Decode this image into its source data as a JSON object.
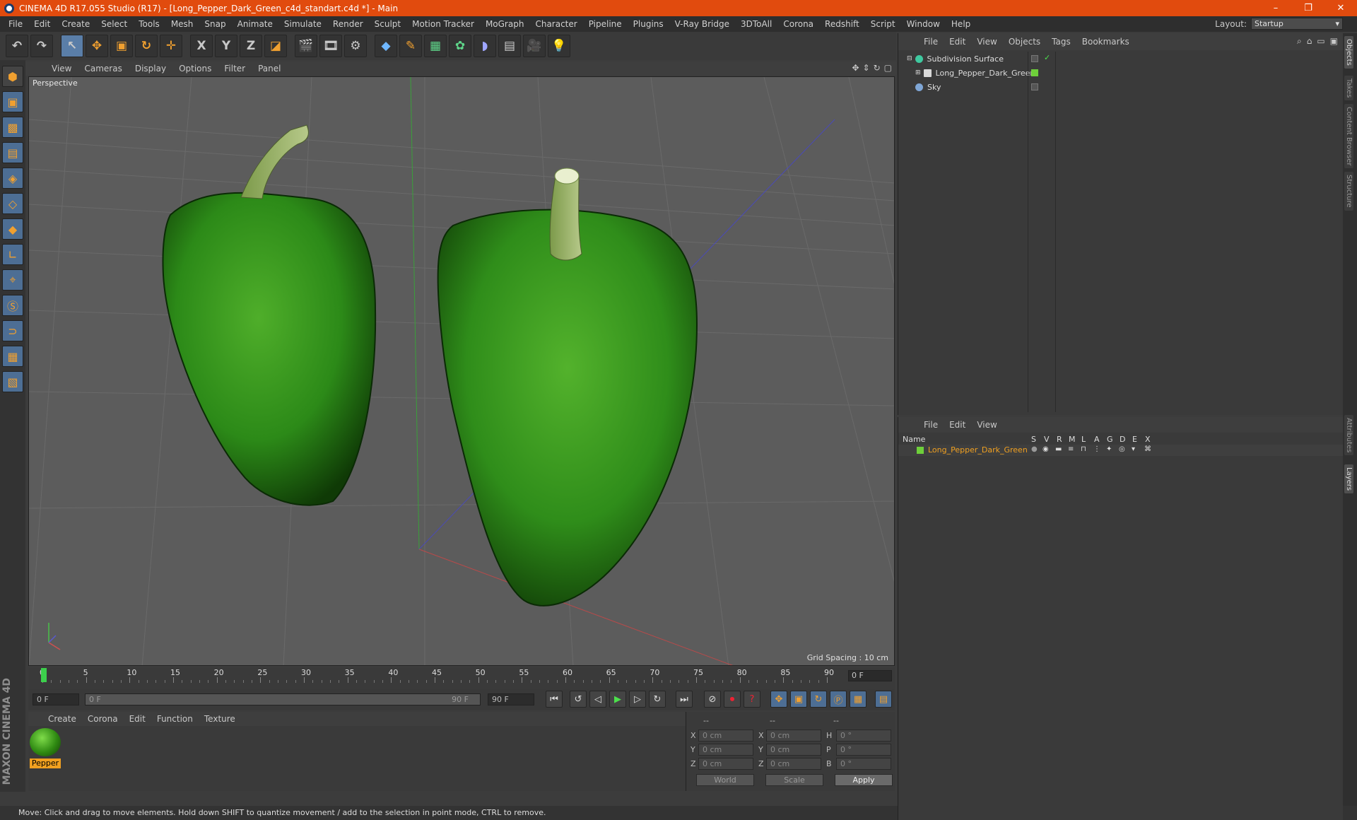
{
  "title_bar": {
    "title": "CINEMA 4D R17.055 Studio (R17) - [Long_Pepper_Dark_Green_c4d_standart.c4d *] - Main",
    "minimize": "–",
    "maximize": "❐",
    "close": "✕"
  },
  "menu": {
    "items": [
      "File",
      "Edit",
      "Create",
      "Select",
      "Tools",
      "Mesh",
      "Snap",
      "Animate",
      "Simulate",
      "Render",
      "Sculpt",
      "Motion Tracker",
      "MoGraph",
      "Character",
      "Pipeline",
      "Plugins",
      "V-Ray Bridge",
      "3DToAll",
      "Corona",
      "Redshift",
      "Script",
      "Window",
      "Help"
    ]
  },
  "layout": {
    "label": "Layout:",
    "value": "Startup"
  },
  "toolbar": {
    "undo": "↶",
    "redo": "↷",
    "axis_x": "X",
    "axis_y": "Y",
    "axis_z": "Z"
  },
  "viewport": {
    "menu": [
      "View",
      "Cameras",
      "Display",
      "Options",
      "Filter",
      "Panel"
    ],
    "label": "Perspective",
    "grid_spacing": "Grid Spacing : 10 cm"
  },
  "timeline": {
    "ticks": [
      "0",
      "5",
      "10",
      "15",
      "20",
      "25",
      "30",
      "35",
      "40",
      "45",
      "50",
      "55",
      "60",
      "65",
      "70",
      "75",
      "80",
      "85",
      "90"
    ],
    "end_field": "0 F",
    "start_field": "0 F",
    "range_start": "0 F",
    "range_end": "90 F",
    "max_field": "90 F"
  },
  "materials": {
    "menu": [
      "Create",
      "Corona",
      "Edit",
      "Function",
      "Texture"
    ],
    "items": [
      {
        "name": "Pepper"
      }
    ]
  },
  "coords": {
    "header": [
      "--",
      "--",
      "--"
    ],
    "rows": [
      {
        "a": "X",
        "v1": "0 cm",
        "b": "X",
        "v2": "0 cm",
        "c": "H",
        "v3": "0 °"
      },
      {
        "a": "Y",
        "v1": "0 cm",
        "b": "Y",
        "v2": "0 cm",
        "c": "P",
        "v3": "0 °"
      },
      {
        "a": "Z",
        "v1": "0 cm",
        "b": "Z",
        "v2": "0 cm",
        "c": "B",
        "v3": "0 °"
      }
    ],
    "space": "World",
    "mode": "Scale",
    "apply": "Apply"
  },
  "objects": {
    "menu": [
      "File",
      "Edit",
      "View",
      "Objects",
      "Tags",
      "Bookmarks"
    ],
    "tree": [
      {
        "name": "Subdivision Surface",
        "indent": 0,
        "color": "#3fc9a0"
      },
      {
        "name": "Long_Pepper_Dark_Green",
        "indent": 1,
        "color": "#d9d9d9"
      },
      {
        "name": "Sky",
        "indent": 0,
        "color": "#7fa6d6"
      }
    ]
  },
  "layers": {
    "menu": [
      "File",
      "Edit",
      "View"
    ],
    "columns": [
      "Name",
      "S",
      "V",
      "R",
      "M",
      "L",
      "A",
      "G",
      "D",
      "E",
      "X"
    ],
    "row": "Long_Pepper_Dark_Green",
    "layer_color": "#6ecf3a"
  },
  "side_tabs": [
    "Objects",
    "Takes",
    "Content Browser",
    "Structure",
    "Attributes",
    "Layers"
  ],
  "brand": "MAXON CINEMA 4D",
  "status": "Move: Click and drag to move elements. Hold down SHIFT to quantize movement / add to the selection in point mode, CTRL to remove."
}
